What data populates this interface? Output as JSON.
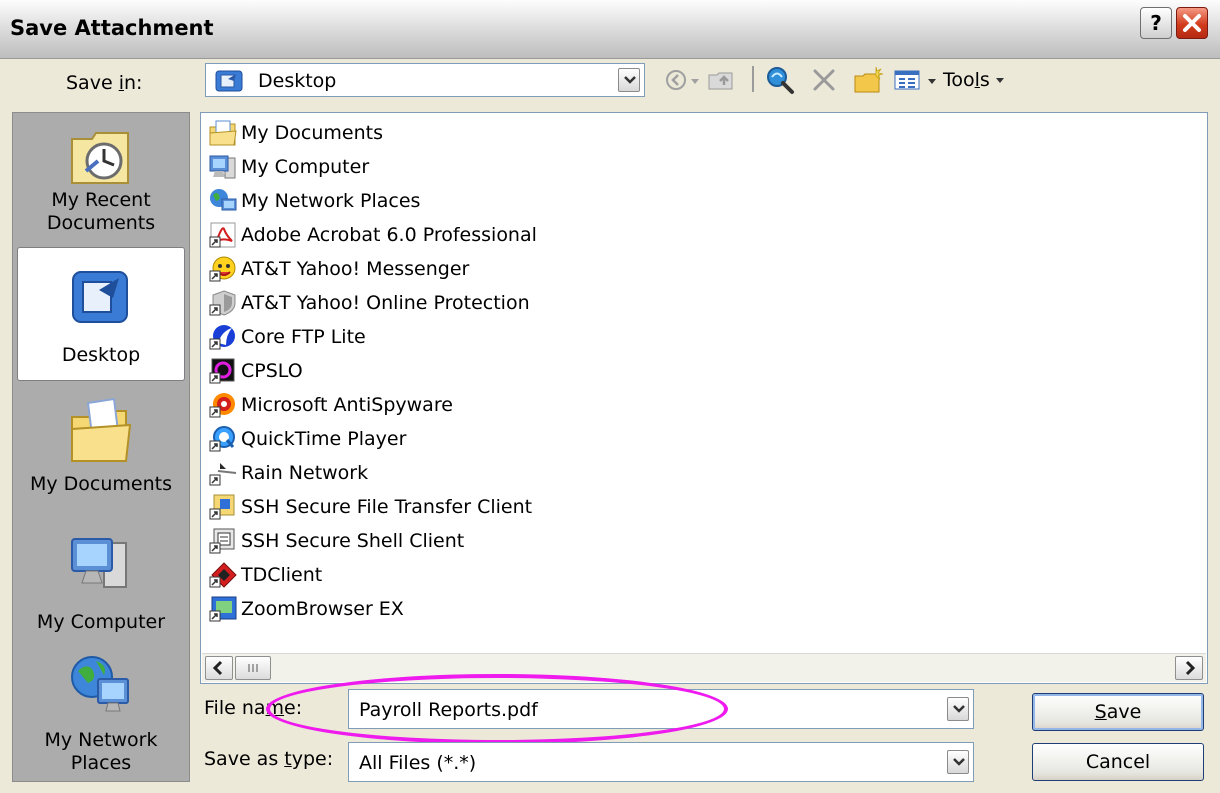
{
  "window": {
    "title": "Save Attachment",
    "help_label": "?",
    "close_icon": "close-icon"
  },
  "save_in": {
    "label_pre": "Save ",
    "label_u": "i",
    "label_post": "n:",
    "value": "Desktop",
    "icon": "desktop-icon"
  },
  "toolbar": {
    "tools_pre": "Too",
    "tools_u": "l",
    "tools_post": "s",
    "buttons": [
      "back-icon",
      "up-folder-icon",
      "search-web-icon",
      "delete-icon",
      "new-folder-icon",
      "views-icon"
    ]
  },
  "places": {
    "recent_line1": "My Recent",
    "recent_line2": "Documents",
    "desktop": "Desktop",
    "documents": "My Documents",
    "computer": "My Computer",
    "network_line1": "My Network",
    "network_line2": "Places"
  },
  "files": [
    {
      "name": "My Documents",
      "icon": "my-documents-icon"
    },
    {
      "name": "My Computer",
      "icon": "my-computer-icon"
    },
    {
      "name": "My Network Places",
      "icon": "network-places-icon"
    },
    {
      "name": "Adobe Acrobat 6.0 Professional",
      "icon": "acrobat-shortcut-icon"
    },
    {
      "name": "AT&T Yahoo! Messenger",
      "icon": "yahoo-messenger-icon"
    },
    {
      "name": "AT&T Yahoo! Online Protection",
      "icon": "online-protection-icon"
    },
    {
      "name": "Core FTP Lite",
      "icon": "core-ftp-icon"
    },
    {
      "name": "CPSLO",
      "icon": "cpslo-icon"
    },
    {
      "name": "Microsoft AntiSpyware",
      "icon": "antispyware-icon"
    },
    {
      "name": "QuickTime Player",
      "icon": "quicktime-icon"
    },
    {
      "name": "Rain Network",
      "icon": "rain-network-icon"
    },
    {
      "name": "SSH Secure File Transfer Client",
      "icon": "ssh-file-transfer-icon"
    },
    {
      "name": "SSH Secure Shell Client",
      "icon": "ssh-shell-icon"
    },
    {
      "name": "TDClient",
      "icon": "tdclient-icon"
    },
    {
      "name": "ZoomBrowser EX",
      "icon": "zoombrowser-icon"
    }
  ],
  "file_name": {
    "label_pre": "File na",
    "label_u": "m",
    "label_post": "e:",
    "value": "Payroll Reports.pdf"
  },
  "save_as_type": {
    "label_pre": "Save as ",
    "label_u": "t",
    "label_post": "ype:",
    "value": "All Files (*.*)"
  },
  "buttons": {
    "save_u": "S",
    "save_rest": "ave",
    "cancel": "Cancel"
  },
  "colors": {
    "highlight_ellipse": "#ee1aee",
    "places_bar": "#acacac",
    "dialog": "#ece9d8"
  }
}
